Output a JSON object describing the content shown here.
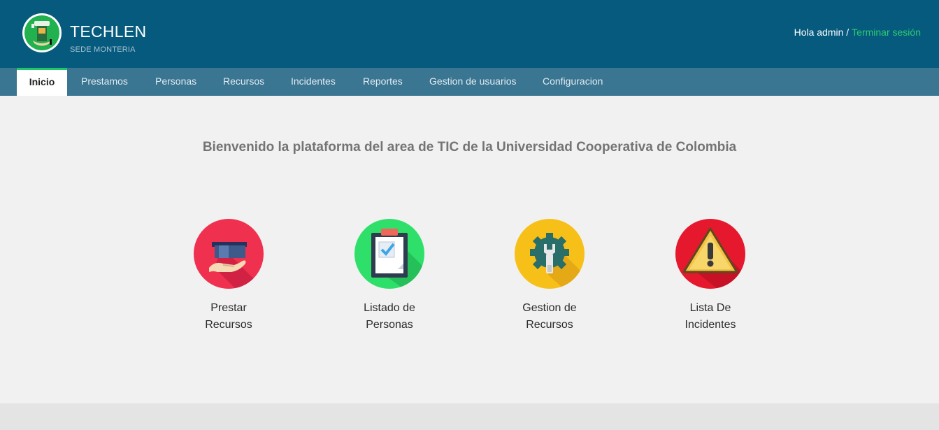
{
  "header": {
    "brand_title": "TECHLEN",
    "brand_subtitle": "SEDE MONTERIA",
    "greeting": "Hola admin /",
    "logout_label": "Terminar sesión"
  },
  "nav": {
    "items": [
      "Inicio",
      "Prestamos",
      "Personas",
      "Recursos",
      "Incidentes",
      "Reportes",
      "Gestion de usuarios",
      "Configuracion"
    ],
    "active": "Inicio"
  },
  "main": {
    "welcome": "Bienvenido la plataforma del area de TIC de la Universidad Cooperativa de Colombia",
    "cards": [
      {
        "line1": "Prestar",
        "line2": "Recursos",
        "icon": "hand-box-icon",
        "color": "#f0304f"
      },
      {
        "line1": "Listado de",
        "line2": "Personas",
        "icon": "clipboard-check-icon",
        "color": "#2ee06a"
      },
      {
        "line1": "Gestion de",
        "line2": "Recursos",
        "icon": "gear-wrench-icon",
        "color": "#f7c018"
      },
      {
        "line1": "Lista De",
        "line2": "Incidentes",
        "icon": "warning-icon",
        "color": "#e5182e"
      }
    ]
  },
  "colors": {
    "header_bg": "#065a7e",
    "nav_bg": "#3a7591",
    "accent_green": "#1fc76a",
    "content_bg": "#f1f1f1"
  }
}
